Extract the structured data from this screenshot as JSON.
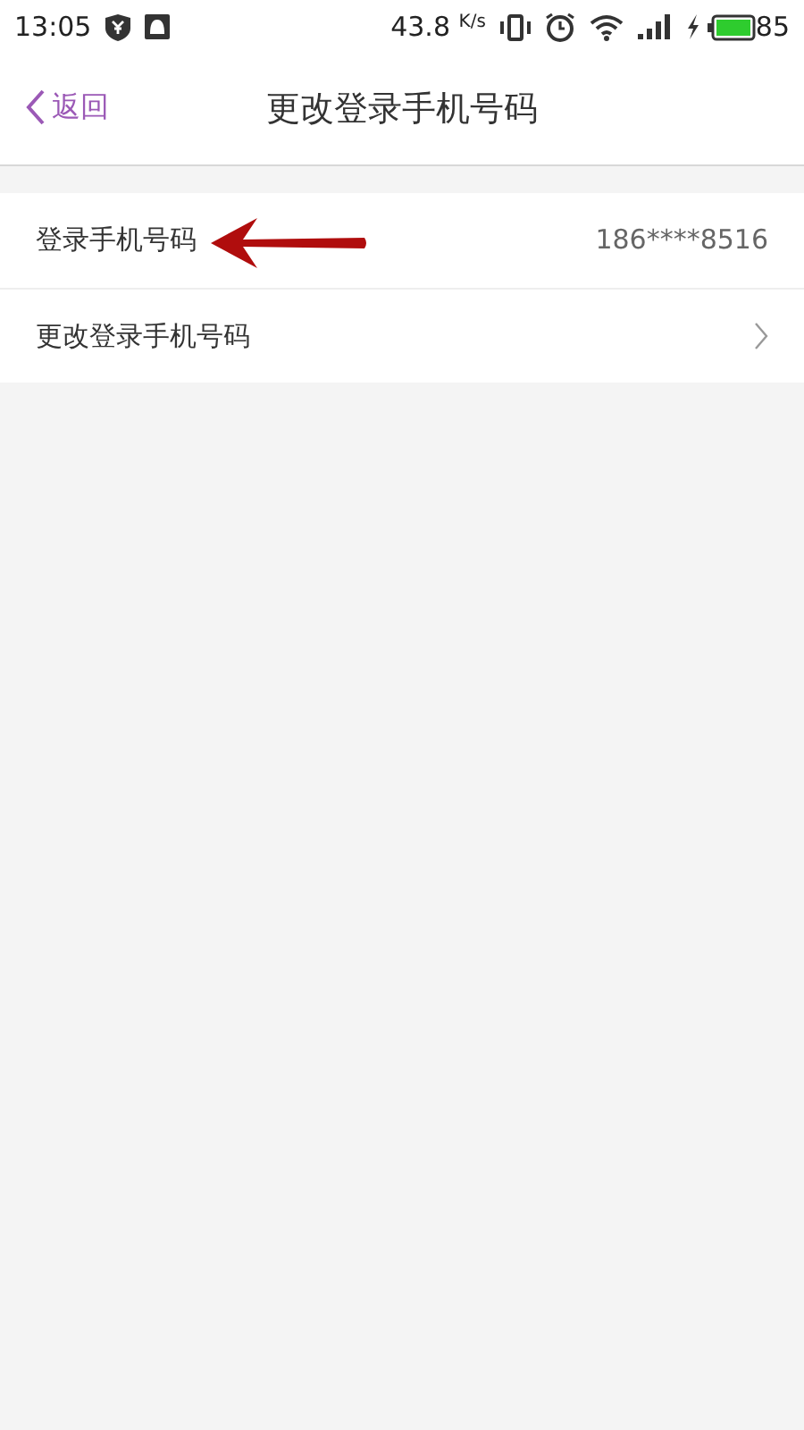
{
  "status_bar": {
    "time": "13:05",
    "speed": "43.8",
    "speed_unit": "K/s",
    "battery": "85"
  },
  "header": {
    "back": "返回",
    "title": "更改登录手机号码"
  },
  "rows": [
    {
      "kind": "value",
      "label": "登录手机号码",
      "value": "186****8516",
      "annotated": true
    },
    {
      "kind": "link",
      "label": "更改登录手机号码",
      "annotated": false
    }
  ]
}
